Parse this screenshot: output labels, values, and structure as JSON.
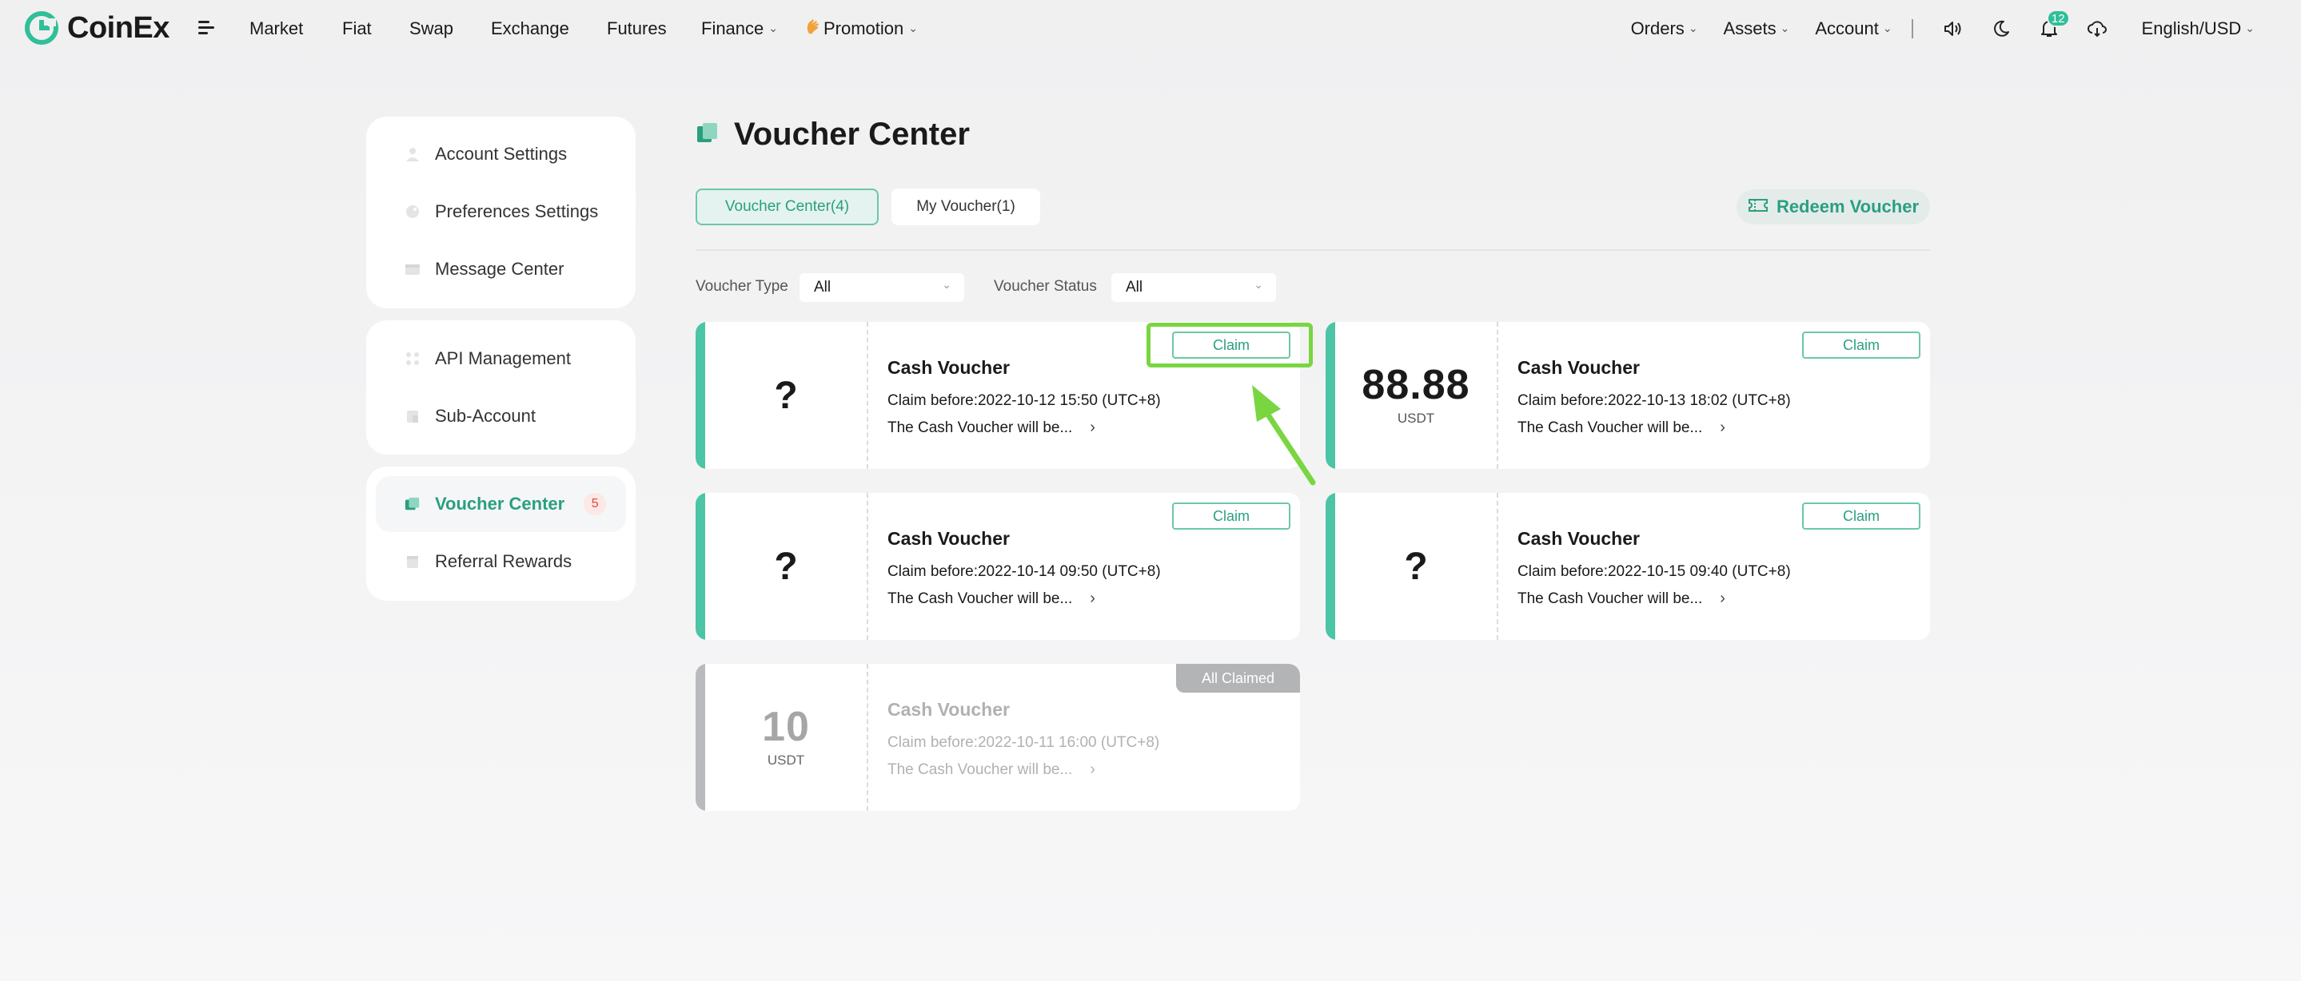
{
  "header": {
    "logo_text": "CoinEx",
    "nav": [
      {
        "label": "Market"
      },
      {
        "label": "Fiat"
      },
      {
        "label": "Swap"
      },
      {
        "label": "Exchange"
      },
      {
        "label": "Futures"
      },
      {
        "label": "Finance"
      },
      {
        "label": "Promotion"
      }
    ],
    "right": {
      "orders": "Orders",
      "assets": "Assets",
      "account": "Account",
      "notification_count": "12",
      "language": "English/USD"
    }
  },
  "sidebar": {
    "groups": [
      {
        "items": [
          {
            "label": "Account Settings",
            "icon": "user-icon"
          },
          {
            "label": "Preferences Settings",
            "icon": "palette-icon"
          },
          {
            "label": "Message Center",
            "icon": "mail-icon"
          }
        ]
      },
      {
        "items": [
          {
            "label": "API Management",
            "icon": "api-icon"
          },
          {
            "label": "Sub-Account",
            "icon": "sub-account-icon"
          }
        ]
      },
      {
        "items": [
          {
            "label": "Voucher Center",
            "icon": "voucher-icon",
            "badge": "5",
            "active": true
          },
          {
            "label": "Referral Rewards",
            "icon": "gift-icon"
          }
        ]
      }
    ]
  },
  "main": {
    "title": "Voucher Center",
    "tabs": [
      {
        "label": "Voucher Center(4)",
        "active": true
      },
      {
        "label": "My Voucher(1)",
        "active": false
      }
    ],
    "redeem_label": "Redeem Voucher",
    "filters": {
      "type_label": "Voucher Type",
      "type_value": "All",
      "status_label": "Voucher Status",
      "status_value": "All"
    },
    "vouchers": [
      {
        "amount": "?",
        "unit": "",
        "title": "Cash Voucher",
        "claim_before": "Claim before:2022-10-12 15:50 (UTC+8)",
        "desc": "The Cash Voucher will be...",
        "action": "Claim"
      },
      {
        "amount": "88.88",
        "unit": "USDT",
        "title": "Cash Voucher",
        "claim_before": "Claim before:2022-10-13 18:02 (UTC+8)",
        "desc": "The Cash Voucher will be...",
        "action": "Claim"
      },
      {
        "amount": "?",
        "unit": "",
        "title": "Cash Voucher",
        "claim_before": "Claim before:2022-10-14 09:50 (UTC+8)",
        "desc": "The Cash Voucher will be...",
        "action": "Claim"
      },
      {
        "amount": "?",
        "unit": "",
        "title": "Cash Voucher",
        "claim_before": "Claim before:2022-10-15 09:40 (UTC+8)",
        "desc": "The Cash Voucher will be...",
        "action": "Claim"
      },
      {
        "amount": "10",
        "unit": "USDT",
        "title": "Cash Voucher",
        "claim_before": "Claim before:2022-10-11 16:00 (UTC+8)",
        "desc": "The Cash Voucher will be...",
        "status": "All Claimed"
      }
    ]
  },
  "colors": {
    "brand": "#2a9f80",
    "accent_light": "#e4f3ef",
    "stripe_active": "#4cc4a6",
    "stripe_claimed": "#b9babd",
    "highlight": "#79d641",
    "badge_red": "#e2473e"
  }
}
